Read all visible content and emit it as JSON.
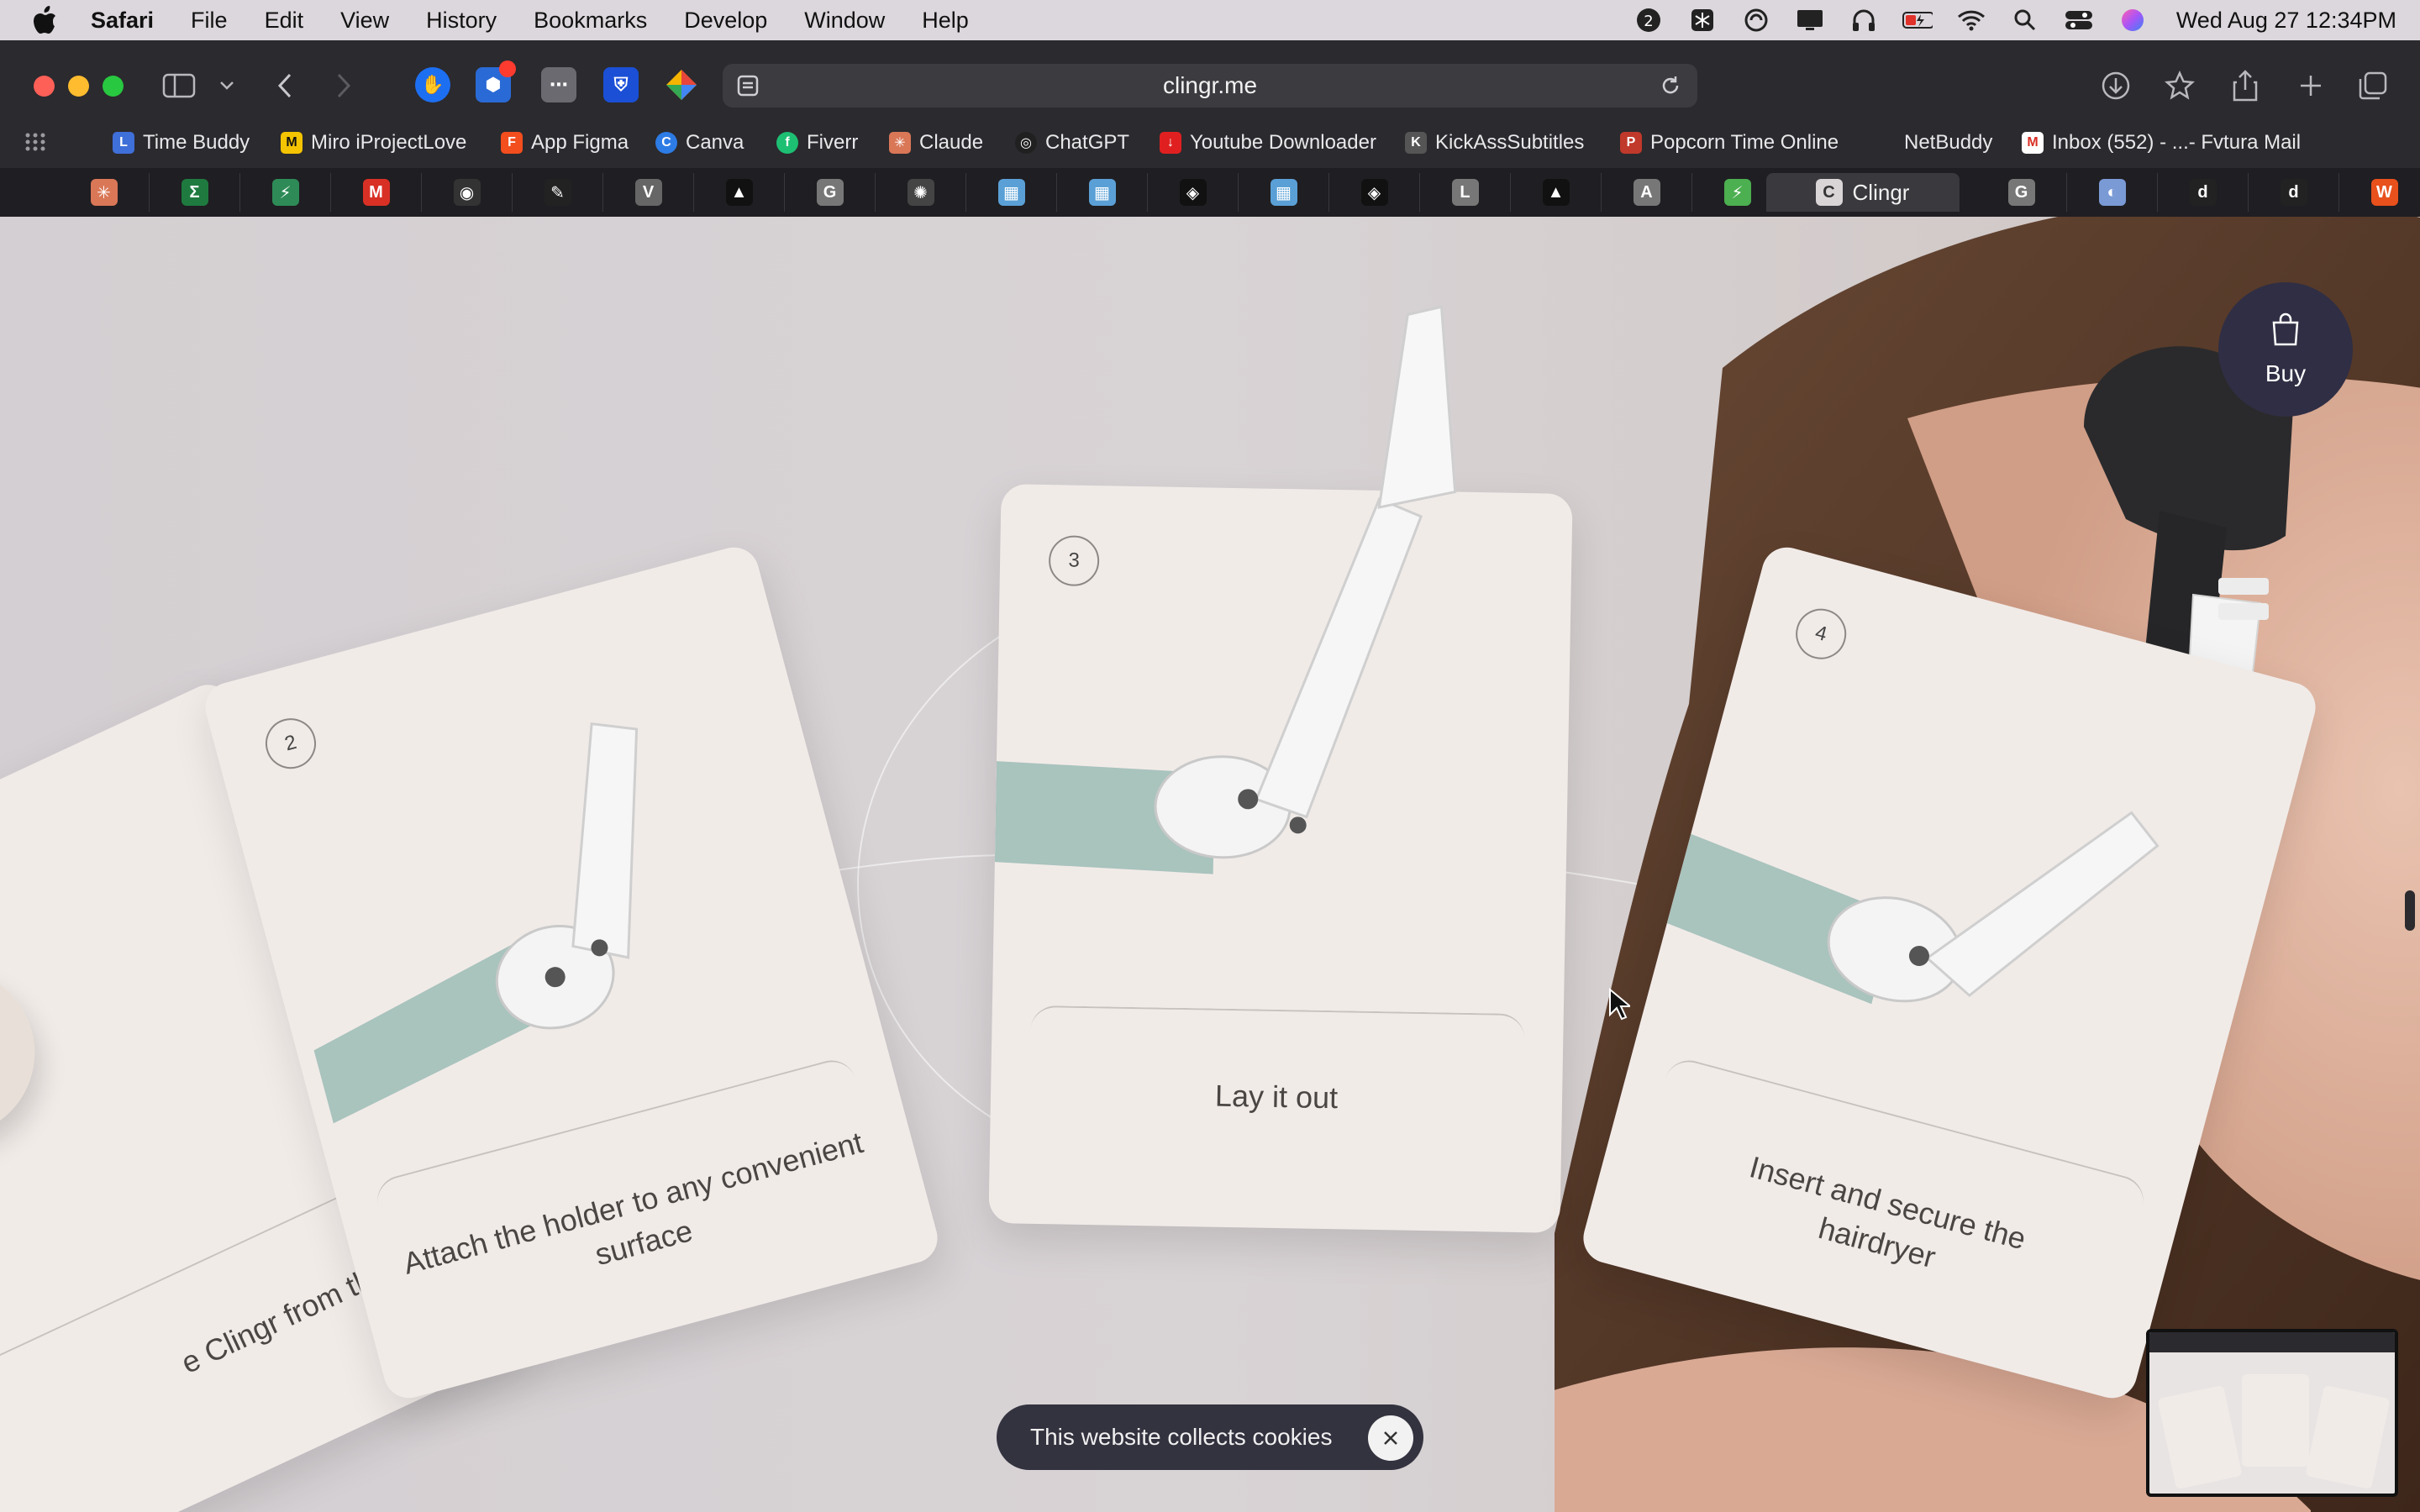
{
  "menubar": {
    "app": "Safari",
    "items": [
      "File",
      "Edit",
      "View",
      "History",
      "Bookmarks",
      "Develop",
      "Window",
      "Help"
    ],
    "clock": "Wed Aug 27  12:34PM",
    "status_icons": [
      "creative-cloud-icon",
      "snowflake-icon",
      "sync-icon",
      "display-icon",
      "headphones-icon",
      "battery-icon",
      "wifi-icon",
      "search-icon",
      "control-center-icon",
      "siri-icon"
    ],
    "badge": "2"
  },
  "browser": {
    "url": "clingr.me",
    "bookmarks": [
      {
        "label": "Time Buddy",
        "color": "#3f6fd8",
        "glyph": "L"
      },
      {
        "label": "Miro iProjectLove",
        "color": "#f5c400",
        "glyph": "M"
      },
      {
        "label": "App Figma",
        "color": "#f24e1e",
        "glyph": "F"
      },
      {
        "label": "Canva",
        "color": "#2d7be5",
        "glyph": "C"
      },
      {
        "label": "Fiverr",
        "color": "#1dbf73",
        "glyph": "f"
      },
      {
        "label": "Claude",
        "color": "#d97757",
        "glyph": "✳"
      },
      {
        "label": "ChatGPT",
        "color": "#202020",
        "glyph": "◎"
      },
      {
        "label": "Youtube Downloader",
        "color": "#e02020",
        "glyph": "↓"
      },
      {
        "label": "KickAssSubtitles",
        "color": "#555555",
        "glyph": "K"
      },
      {
        "label": "Popcorn Time Online",
        "color": "#c0392b",
        "glyph": "P"
      },
      {
        "label": "NetBuddy",
        "color": "",
        "glyph": ""
      },
      {
        "label": "Inbox (552) - ...- Fvtura Mail",
        "color": "#d93025",
        "glyph": "M"
      }
    ],
    "pinned_tabs": [
      {
        "glyph": "✳",
        "color": "#d97757"
      },
      {
        "glyph": "Σ",
        "color": "#1f7a3f"
      },
      {
        "glyph": "⚡",
        "color": "#2e8b57"
      },
      {
        "glyph": "M",
        "color": "#d93025"
      },
      {
        "glyph": "◉",
        "color": "#333333"
      },
      {
        "glyph": "✎",
        "color": "#222222"
      },
      {
        "glyph": "V",
        "color": "#666666"
      },
      {
        "glyph": "▲",
        "color": "#111111"
      },
      {
        "glyph": "G",
        "color": "#777777"
      },
      {
        "glyph": "✺",
        "color": "#444444"
      },
      {
        "glyph": "▦",
        "color": "#5aa0d6"
      },
      {
        "glyph": "▦",
        "color": "#5aa0d6"
      },
      {
        "glyph": "◈",
        "color": "#111111"
      },
      {
        "glyph": "▦",
        "color": "#5aa0d6"
      },
      {
        "glyph": "◈",
        "color": "#111111"
      },
      {
        "glyph": "L",
        "color": "#777777"
      },
      {
        "glyph": "▲",
        "color": "#111111"
      },
      {
        "glyph": "A",
        "color": "#777777"
      },
      {
        "glyph": "⚡",
        "color": "#4caf50"
      }
    ],
    "active_tab": {
      "label": "Clingr"
    },
    "trailing_tabs": [
      {
        "glyph": "G",
        "color": "#777777"
      },
      {
        "glyph": "◐",
        "color": "#7a9ad6"
      },
      {
        "glyph": "d",
        "color": "#222222"
      },
      {
        "glyph": "d",
        "color": "#222222"
      },
      {
        "glyph": "W",
        "color": "#e8501c"
      }
    ]
  },
  "page": {
    "cards": [
      {
        "number": "",
        "caption": "e Clingr from the bag"
      },
      {
        "number": "2",
        "caption": "Attach the holder to any convenient surface"
      },
      {
        "number": "3",
        "caption": "Lay it out"
      },
      {
        "number": "4",
        "caption": "Insert and secure the hairdryer"
      }
    ],
    "buy_label": "Buy",
    "cookie_text": "This website collects cookies",
    "colors": {
      "accent": "#2f2e44",
      "card": "#f1ebe8",
      "teal": "#a9c3bd"
    }
  }
}
